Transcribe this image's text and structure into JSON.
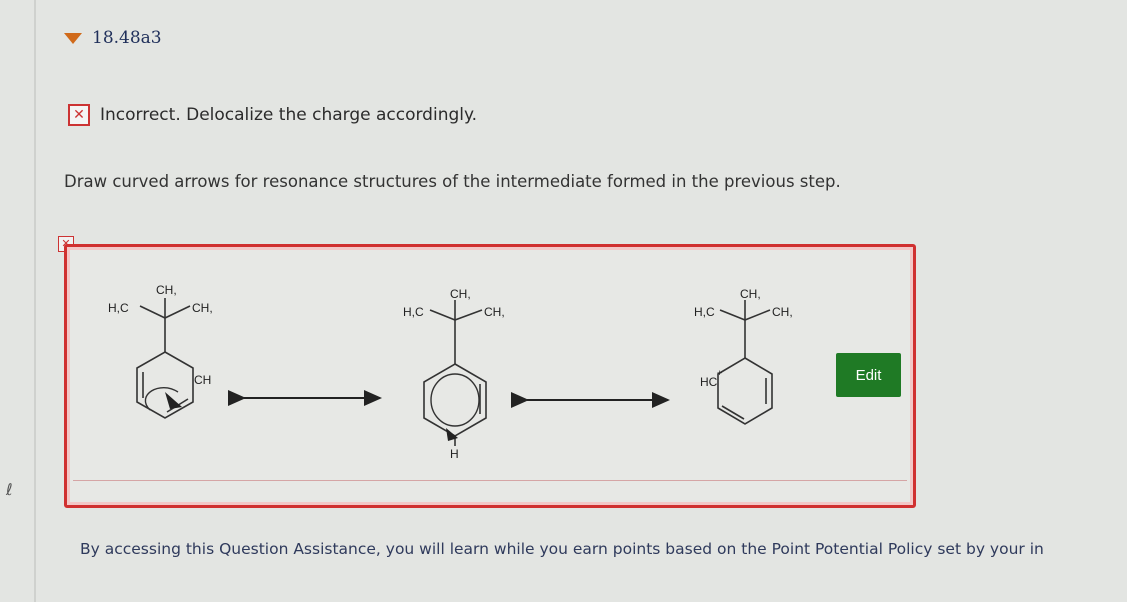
{
  "question": {
    "title": "18.48a3"
  },
  "feedback": {
    "status_icon": "incorrect-icon",
    "message": "Incorrect. Delocalize the charge accordingly."
  },
  "instructions": "Draw curved arrows for resonance structures of the intermediate formed in the previous step.",
  "answer": {
    "edit_label": "Edit",
    "structures": [
      {
        "top": "CH,",
        "left": "H,C",
        "right": "CH,",
        "ring_label": "CH"
      },
      {
        "top": "CH,",
        "left": "H,C",
        "right": "CH,",
        "ring_label": "H"
      },
      {
        "top": "CH,",
        "left": "H,C",
        "right": "CH,",
        "ring_label": "HC"
      }
    ]
  },
  "footer": {
    "text": "By accessing this Question Assistance, you will learn while you earn points based on the Point Potential Policy set by your in"
  },
  "colors": {
    "incorrect": "#d03030",
    "edit_button": "#1f7a25",
    "accent": "#d06a1a"
  }
}
